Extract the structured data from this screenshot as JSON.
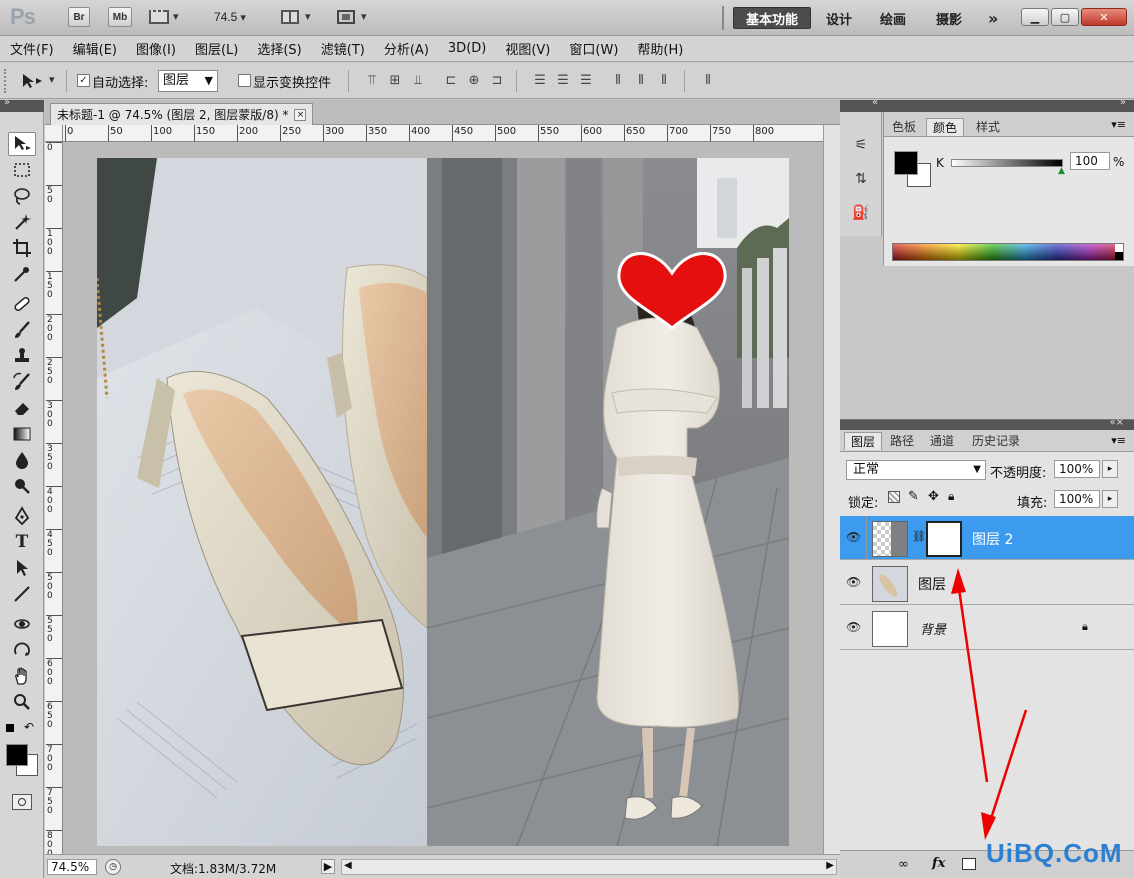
{
  "appbar": {
    "logo": "Ps",
    "br": "Br",
    "mb": "Mb",
    "zoom": "74.5",
    "workspaces": [
      "基本功能",
      "设计",
      "绘画",
      "摄影"
    ],
    "more": "»"
  },
  "menu": [
    "文件(F)",
    "编辑(E)",
    "图像(I)",
    "图层(L)",
    "选择(S)",
    "滤镜(T)",
    "分析(A)",
    "3D(D)",
    "视图(V)",
    "窗口(W)",
    "帮助(H)"
  ],
  "options": {
    "auto_select_label": "自动选择:",
    "auto_select_checked": "✓",
    "auto_select_value": "图层",
    "show_transform_label": "显示变换控件"
  },
  "document": {
    "tab_title": "未标题-1 @ 74.5% (图层 2, 图层蒙版/8) *",
    "close": "×",
    "ruler_h": [
      "0",
      "50",
      "100",
      "150",
      "200",
      "250",
      "300",
      "350",
      "400",
      "450",
      "500",
      "550",
      "600",
      "650",
      "700",
      "750",
      "800"
    ],
    "ruler_v": [
      "0",
      "50",
      "100",
      "150",
      "200",
      "250",
      "300",
      "350",
      "400",
      "450",
      "500",
      "550",
      "600",
      "650",
      "700",
      "750",
      "800"
    ],
    "status_zoom": "74.5%",
    "status_doc": "文档:1.83M/3.72M"
  },
  "color_panel": {
    "tabs": [
      "色板",
      "颜色",
      "样式"
    ],
    "active_tab": "颜色",
    "channel": "K",
    "value": "100",
    "unit": "%",
    "fg": "#000000",
    "bg": "#ffffff"
  },
  "layers_panel": {
    "tabs": [
      "图层",
      "路径",
      "通道",
      "历史记录"
    ],
    "blend_mode": "正常",
    "opacity_label": "不透明度:",
    "opacity": "100%",
    "lock_label": "锁定:",
    "fill_label": "填充:",
    "fill": "100%",
    "layers": [
      {
        "name": "图层 2",
        "selected": true,
        "has_mask": true
      },
      {
        "name": "图层",
        "selected": false,
        "has_mask": false
      },
      {
        "name": "背景",
        "selected": false,
        "locked": true
      }
    ],
    "footer": [
      "∞",
      "fx"
    ]
  },
  "watermark": "UiBQ.CoM"
}
